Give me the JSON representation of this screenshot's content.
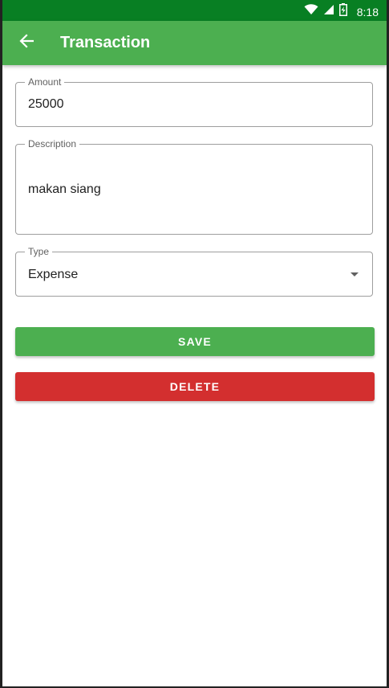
{
  "status_bar": {
    "time": "8:18",
    "icons": [
      "wifi-icon",
      "signal-icon",
      "battery-charging-icon"
    ],
    "background": "#087f23"
  },
  "app_bar": {
    "title": "Transaction",
    "back_icon": "arrow-back-icon",
    "background": "#4caf50"
  },
  "form": {
    "amount": {
      "label": "Amount",
      "value": "25000"
    },
    "description": {
      "label": "Description",
      "value": "makan siang"
    },
    "type": {
      "label": "Type",
      "value": "Expense",
      "icon": "dropdown-arrow-icon"
    }
  },
  "buttons": {
    "save": {
      "label": "SAVE",
      "color": "#4caf50"
    },
    "delete": {
      "label": "DELETE",
      "color": "#d32f2f"
    }
  }
}
